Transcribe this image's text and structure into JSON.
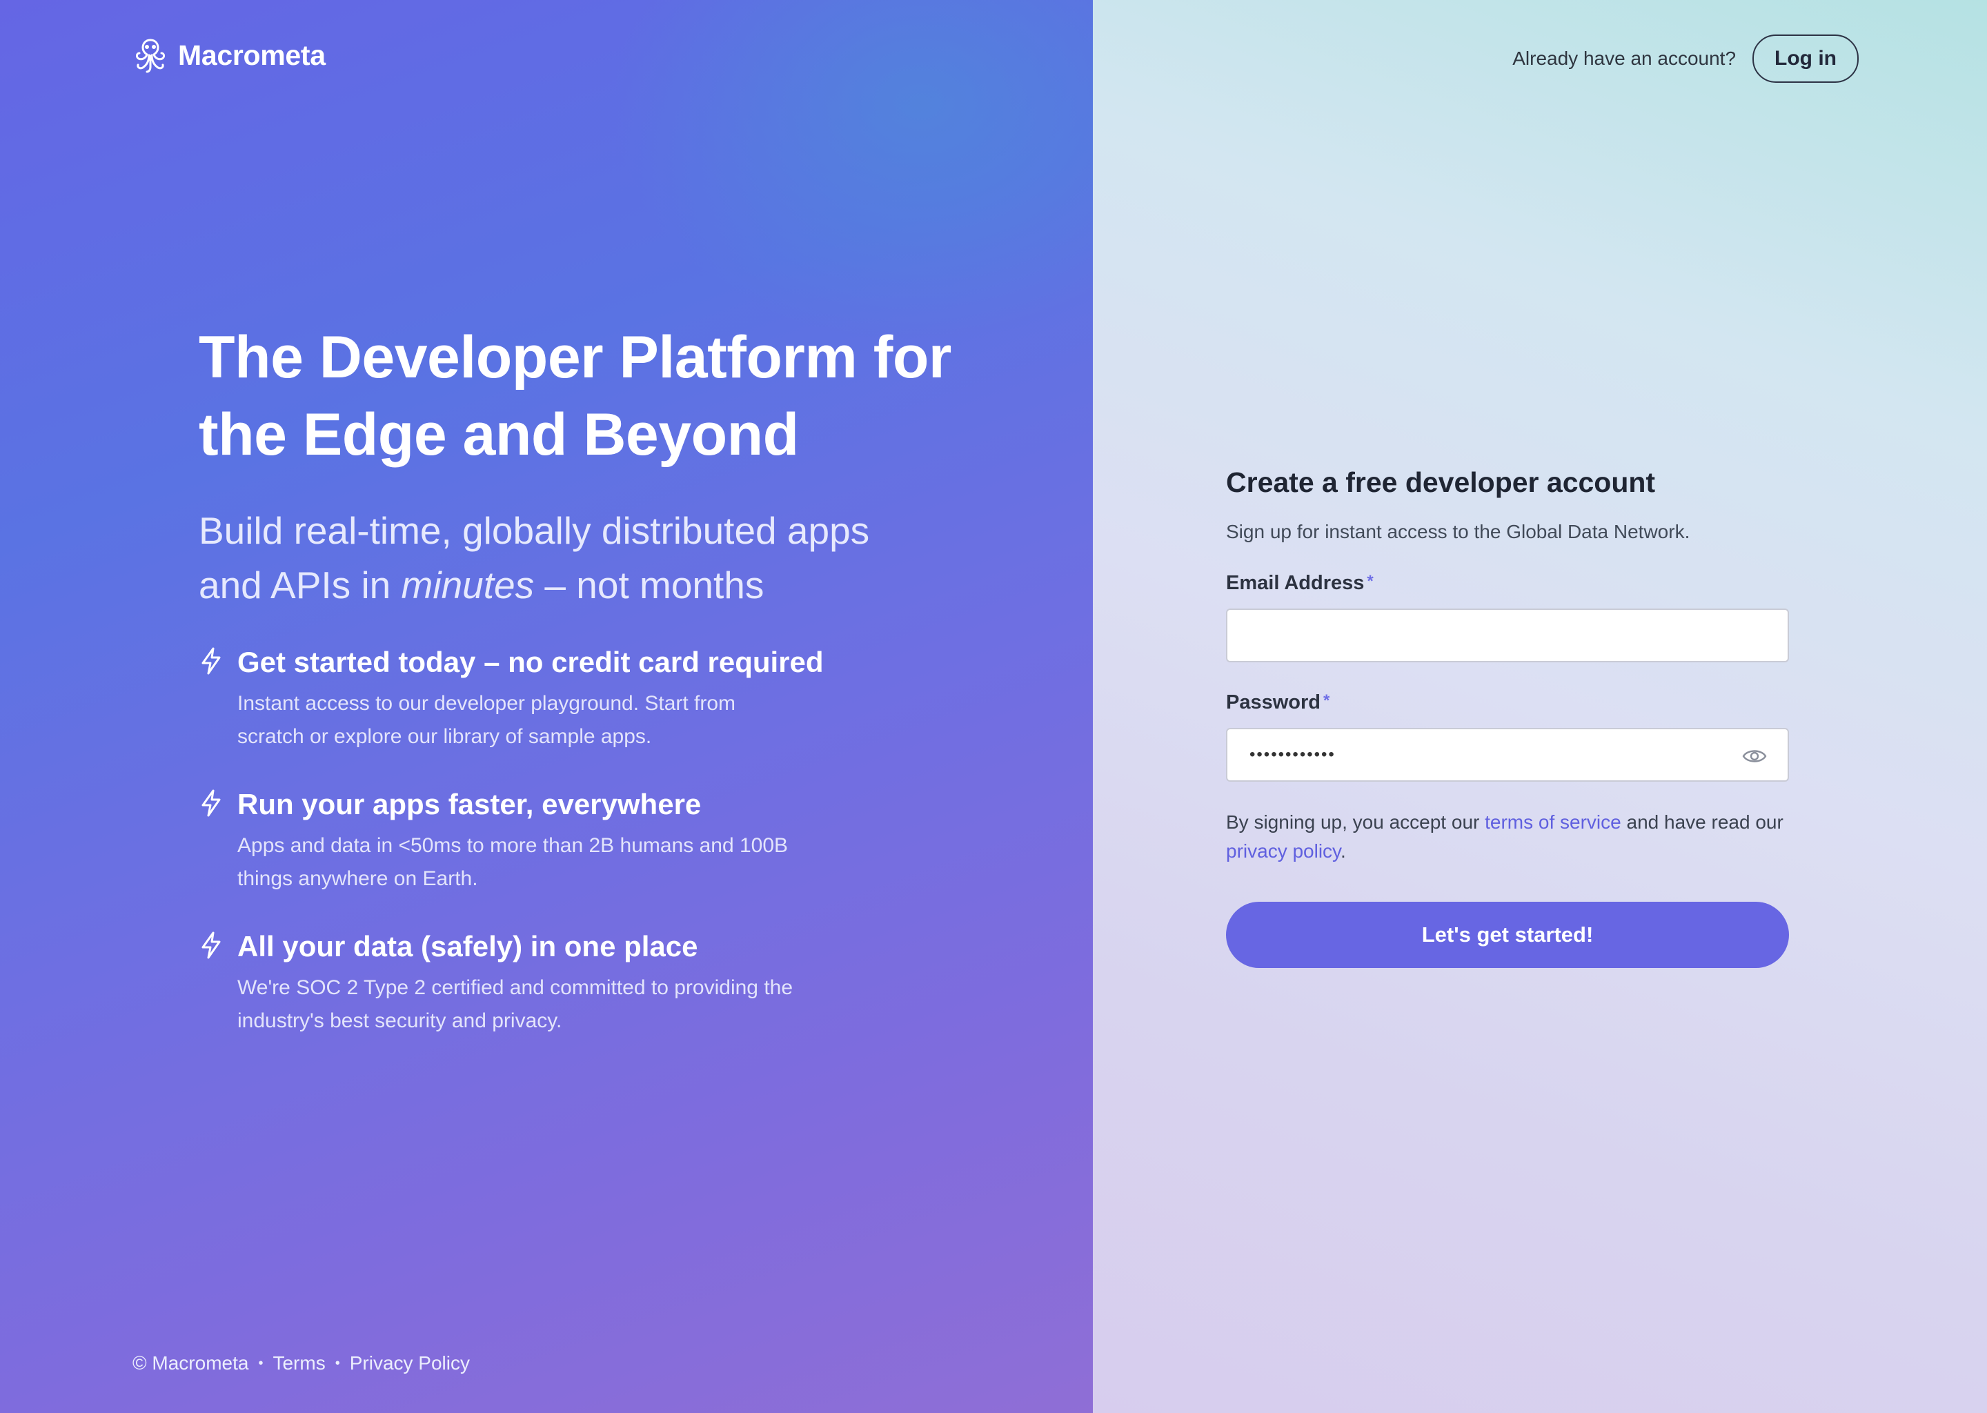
{
  "brand": {
    "name": "Macrometa",
    "icon": "octopus-logo-icon"
  },
  "hero": {
    "title": "The Developer Platform for the Edge and Beyond",
    "subtitle_pre": "Build real-time, globally distributed apps and APIs in ",
    "subtitle_em": "minutes",
    "subtitle_post": " – not months"
  },
  "features": [
    {
      "icon": "lightning-bolt-icon",
      "title": "Get started today – no credit card required",
      "body": "Instant access to our developer playground. Start from scratch or explore our library of sample apps."
    },
    {
      "icon": "lightning-bolt-icon",
      "title": "Run your apps faster, everywhere",
      "body": "Apps and data in <50ms to more than 2B humans and 100B things anywhere on Earth."
    },
    {
      "icon": "lightning-bolt-icon",
      "title": "All your data (safely) in one place",
      "body": "We're SOC 2 Type 2 certified and committed to providing the industry's best security and privacy."
    }
  ],
  "footer": {
    "copyright": "© Macrometa",
    "sep": "•",
    "terms": "Terms",
    "privacy": "Privacy Policy"
  },
  "topbar": {
    "prompt": "Already have an account?",
    "login_label": "Log in"
  },
  "signup": {
    "title": "Create a free developer account",
    "description": "Sign up for instant access to the Global Data Network.",
    "email_label": "Email Address",
    "email_value": "",
    "password_label": "Password",
    "password_value": "••••••••••••",
    "required_mark": "*",
    "terms_pre": "By signing up, you accept our ",
    "terms_link": "terms of service",
    "terms_mid": " and have read our ",
    "privacy_link": "privacy policy",
    "terms_post": ".",
    "cta_label": "Let's get started!"
  },
  "colors": {
    "accent": "#6766e3",
    "link": "#6060df",
    "left_gradient_start": "#6566e4",
    "left_gradient_end": "#8f6ed6"
  }
}
